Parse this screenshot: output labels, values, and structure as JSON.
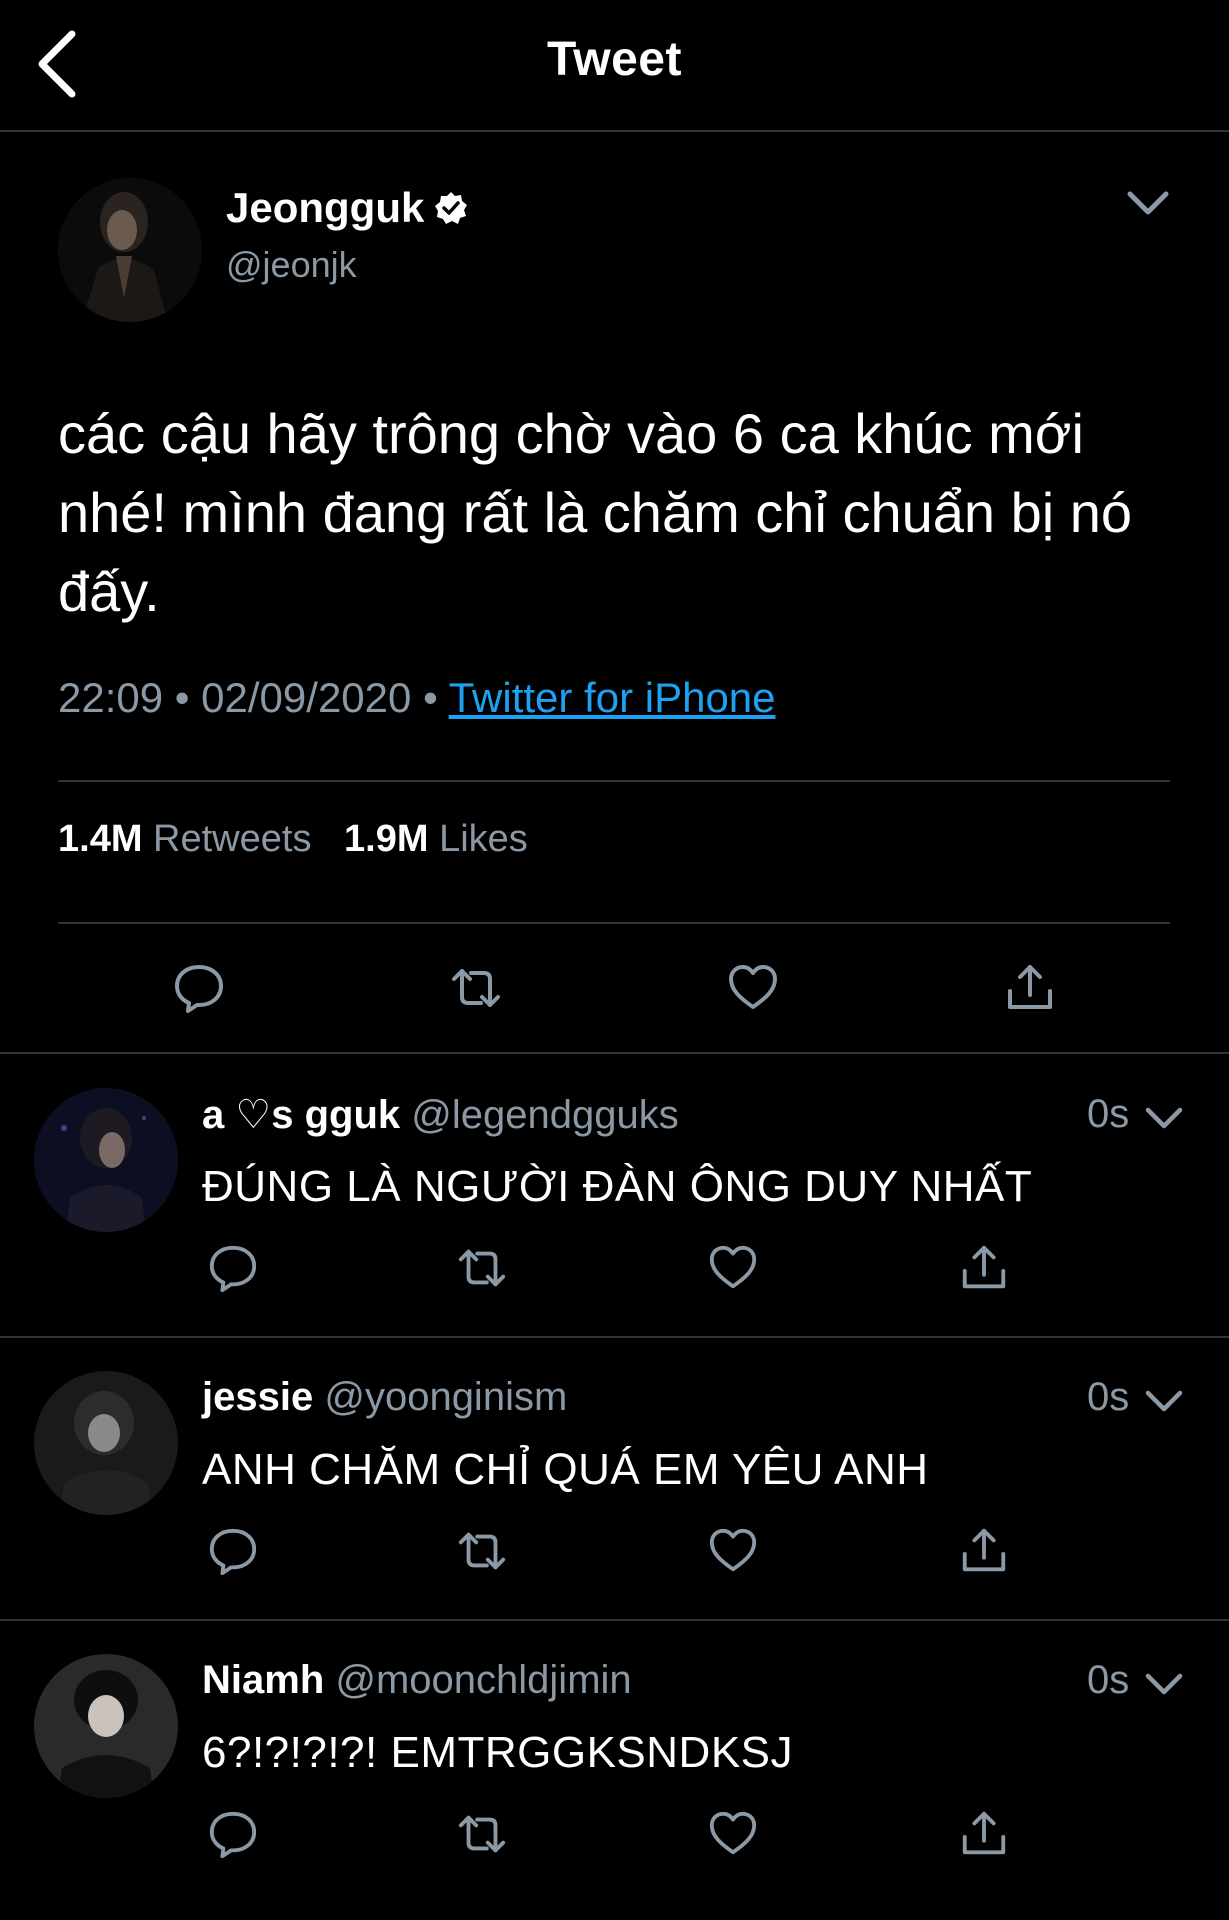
{
  "header": {
    "back_icon": "chevron-left-icon",
    "title": "Tweet"
  },
  "tweet": {
    "display_name": "Jeongguk",
    "verified_icon": "verified-badge-icon",
    "handle": "@jeonjk",
    "text": "các cậu hãy trông chờ vào 6 ca khúc mới nhé! mình đang rất là chăm chỉ chuẩn bị nó đấy.",
    "time": "22:09",
    "date": "02/09/2020",
    "separator": "•",
    "source": "Twitter for iPhone",
    "retweets_count": "1.4M",
    "retweets_label": "Retweets",
    "likes_count": "1.9M",
    "likes_label": "Likes",
    "actions": [
      "reply-icon",
      "retweet-icon",
      "like-icon",
      "share-icon"
    ]
  },
  "replies": [
    {
      "display_name": "a ♡s gguk",
      "handle": "@legendgguks",
      "time": "0s",
      "text": "ĐÚNG LÀ NGƯỜI ĐÀN ÔNG DUY NHẤT"
    },
    {
      "display_name": "jessie",
      "handle": "@yoonginism",
      "time": "0s",
      "text": "ANH CHĂM CHỈ QUÁ EM YÊU ANH"
    },
    {
      "display_name": "Niamh",
      "handle": "@moonchldjimin",
      "time": "0s",
      "text": "6?!?!?!?! EMTRGGKSNDKSJ"
    }
  ],
  "colors": {
    "background": "#000000",
    "text": "#ffffff",
    "secondary": "#8b98a5",
    "link": "#1da1f2",
    "divider": "#2f3336"
  }
}
